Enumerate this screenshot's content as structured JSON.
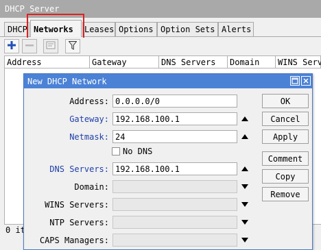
{
  "main_window": {
    "title": "DHCP Server",
    "tabs": [
      {
        "label": "DHCP",
        "active": false
      },
      {
        "label": "Networks",
        "active": true
      },
      {
        "label": "Leases",
        "active": false
      },
      {
        "label": "Options",
        "active": false
      },
      {
        "label": "Option Sets",
        "active": false
      },
      {
        "label": "Alerts",
        "active": false
      }
    ],
    "toolbar": {
      "icons": [
        "plus-icon",
        "minus-icon",
        "note-icon",
        "filter-icon"
      ]
    },
    "table": {
      "columns": [
        "Address",
        "Gateway",
        "DNS Servers",
        "Domain",
        "WINS Serve"
      ],
      "rows": []
    },
    "status": "0 it"
  },
  "dialog": {
    "title": "New DHCP Network",
    "fields": [
      {
        "label": "Address:",
        "value": "0.0.0.0/0",
        "highlighted": false,
        "enabled": true
      },
      {
        "label": "Gateway:",
        "value": "192.168.100.1",
        "highlighted": true,
        "enabled": true
      },
      {
        "label": "Netmask:",
        "value": "24",
        "highlighted": true,
        "enabled": true
      },
      {
        "label": "DNS Servers:",
        "value": "192.168.100.1",
        "highlighted": true,
        "enabled": true
      },
      {
        "label": "Domain:",
        "value": "",
        "highlighted": false,
        "enabled": true
      },
      {
        "label": "WINS Servers:",
        "value": "",
        "highlighted": false,
        "enabled": false
      },
      {
        "label": "NTP Servers:",
        "value": "",
        "highlighted": false,
        "enabled": false
      },
      {
        "label": "CAPS Managers:",
        "value": "",
        "highlighted": false,
        "enabled": false
      }
    ],
    "no_dns_label": "No DNS",
    "no_dns_checked": false,
    "buttons": [
      "OK",
      "Cancel",
      "Apply",
      "Comment",
      "Copy",
      "Remove"
    ]
  },
  "colors": {
    "title_bar": "#a9a9a9",
    "dialog_title": "#4b82d6",
    "label_blue": "#1f3fa8",
    "highlight_box": "#e02020",
    "add_icon": "#1f4fb8"
  }
}
